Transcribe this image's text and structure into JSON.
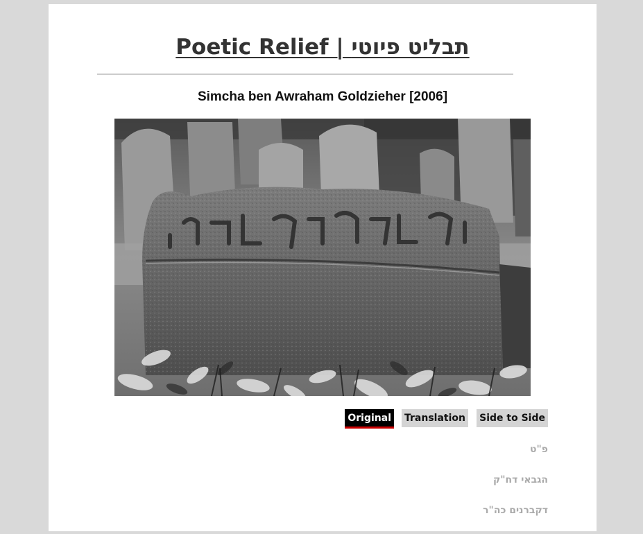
{
  "header": {
    "site_title": "Poetic Relief | תבליט פיוטי"
  },
  "poem": {
    "title": "Simcha ben Awraham Goldzieher [2006]",
    "photo_alt": "Weathered gravestone in a Jewish cemetery",
    "lines": [
      "פ\"ט",
      "הגבאי דח\"ק",
      "דקברנים כה\"ר"
    ]
  },
  "tabs": {
    "original": "Original",
    "translation": "Translation",
    "side_by_side": "Side to Side",
    "active": "original"
  },
  "colors": {
    "background": "#d9d9d9",
    "page": "#ffffff",
    "active_tab_bg": "#000000",
    "active_tab_underline": "#cc0000",
    "tab_bg": "#d4d4d4",
    "poem_text": "#aaaaaa"
  }
}
